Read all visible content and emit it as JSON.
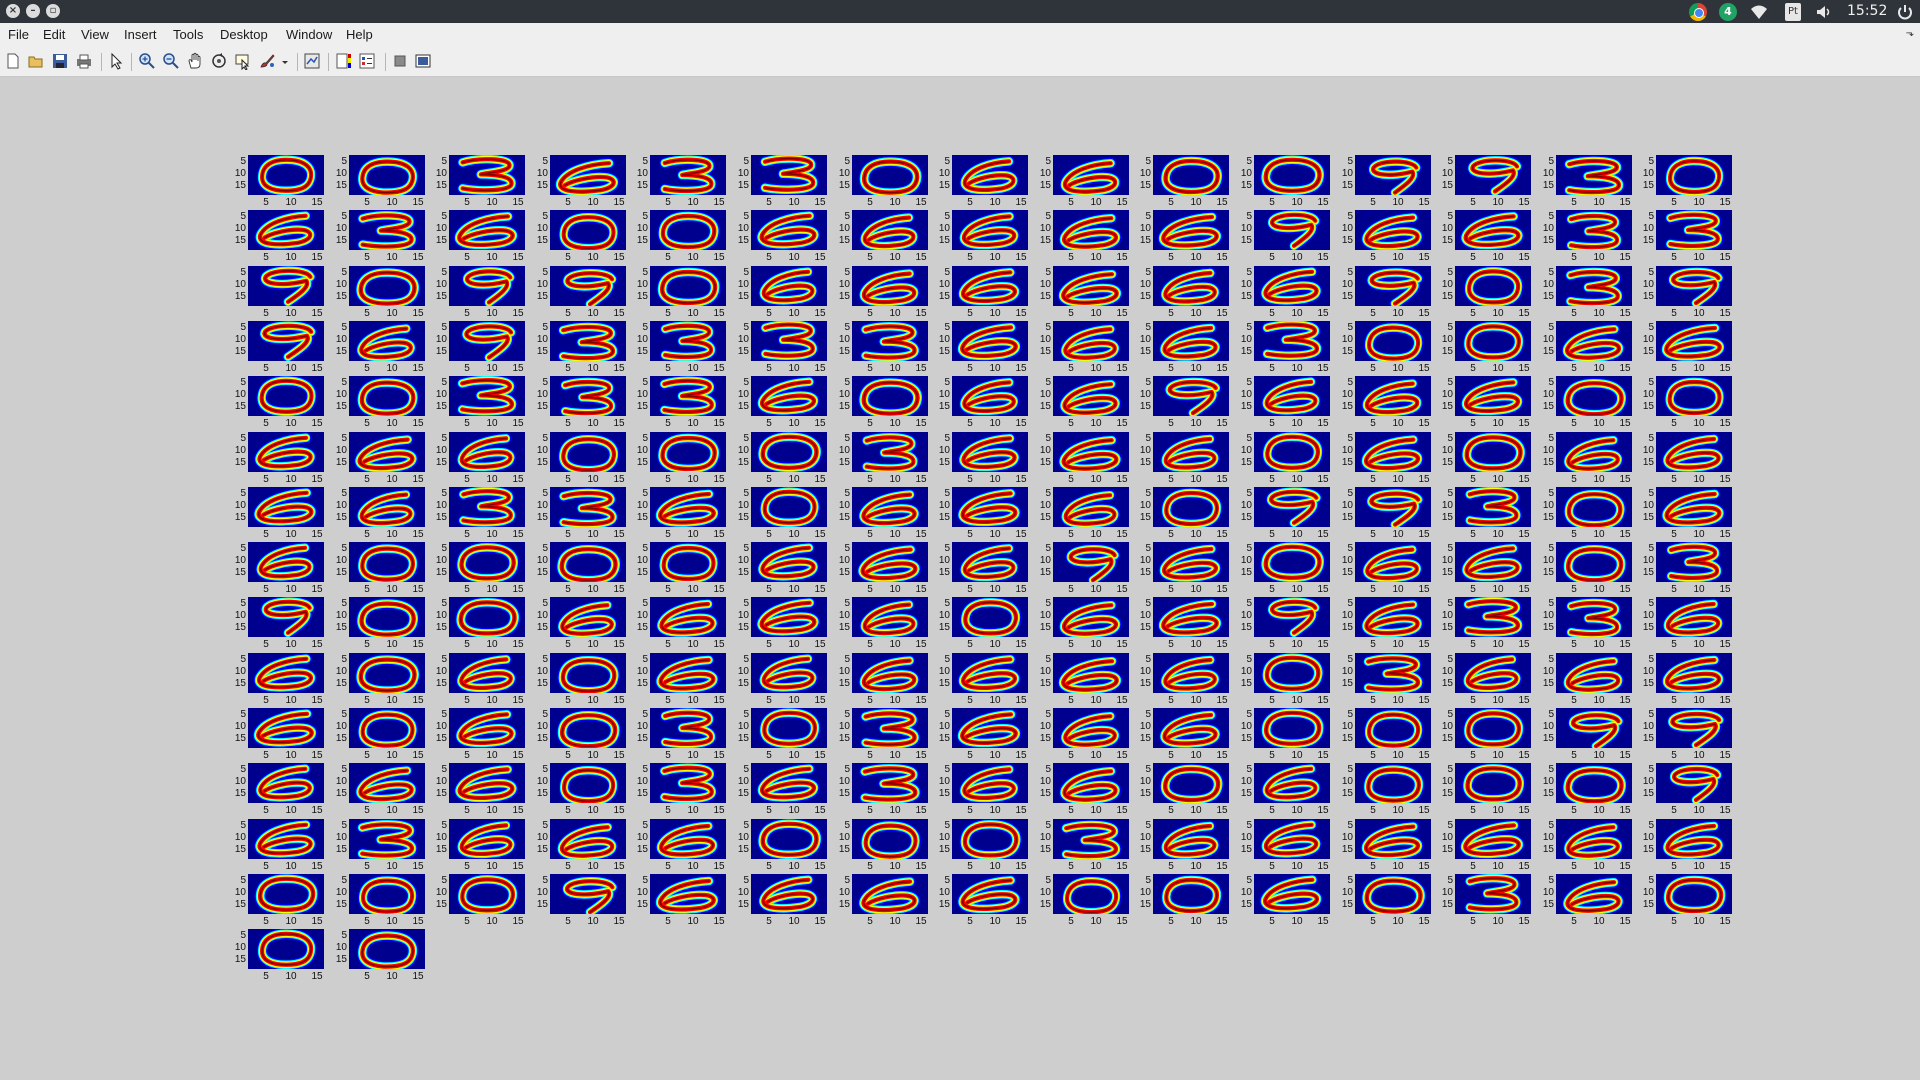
{
  "system_bar": {
    "window_buttons": [
      "close-icon",
      "minimize-icon",
      "maximize-icon"
    ],
    "badge_count": "4",
    "keyboard_layout": "Pt",
    "clock": "15:52",
    "tray_icons": [
      "chrome-icon",
      "notification-badge-icon",
      "wifi-icon",
      "keyboard-layout-icon",
      "volume-icon",
      "power-icon"
    ]
  },
  "menubar": {
    "items": [
      {
        "label": "File"
      },
      {
        "label": "Edit"
      },
      {
        "label": "View"
      },
      {
        "label": "Insert"
      },
      {
        "label": "Tools"
      },
      {
        "label": "Desktop"
      },
      {
        "label": "Window"
      },
      {
        "label": "Help"
      }
    ]
  },
  "toolbar": {
    "buttons": [
      "new-figure-icon",
      "open-file-icon",
      "save-icon",
      "print-icon",
      "edit-plot-icon",
      "zoom-in-icon",
      "zoom-out-icon",
      "pan-icon",
      "rotate-3d-icon",
      "data-cursor-icon",
      "brush-icon",
      "link-plot-icon",
      "colorbar-icon",
      "legend-icon",
      "hide-plot-tools-icon",
      "show-plot-tools-icon"
    ]
  },
  "figure": {
    "y_ticks": [
      "5",
      "10",
      "15"
    ],
    "x_ticks": [
      "5",
      "10",
      "15"
    ],
    "colormap": [
      "#00008f",
      "#0000ff",
      "#00ffff",
      "#ffff00",
      "#ff0000",
      "#800000"
    ],
    "grid_columns": 15,
    "subplots": [
      "0",
      "0",
      "3",
      "6",
      "3",
      "3",
      "0",
      "6",
      "6",
      "0",
      "0",
      "9",
      "9",
      "3",
      "0",
      "6",
      "3",
      "6",
      "0",
      "0",
      "6",
      "6",
      "6",
      "6",
      "6",
      "9",
      "6",
      "6",
      "3",
      "3",
      "9",
      "0",
      "9",
      "9",
      "0",
      "6",
      "6",
      "6",
      "6",
      "6",
      "6",
      "9",
      "0",
      "3",
      "9",
      "9",
      "6",
      "9",
      "3",
      "3",
      "3",
      "3",
      "6",
      "6",
      "6",
      "3",
      "0",
      "0",
      "6",
      "6",
      "0",
      "0",
      "3",
      "3",
      "3",
      "6",
      "0",
      "6",
      "6",
      "9",
      "6",
      "6",
      "6",
      "0",
      "0",
      "6",
      "6",
      "6",
      "0",
      "0",
      "0",
      "3",
      "6",
      "6",
      "6",
      "0",
      "6",
      "0",
      "6",
      "6",
      "6",
      "6",
      "3",
      "3",
      "6",
      "0",
      "6",
      "6",
      "6",
      "0",
      "9",
      "9",
      "3",
      "0",
      "6",
      "6",
      "0",
      "0",
      "0",
      "0",
      "6",
      "6",
      "6",
      "9",
      "6",
      "0",
      "6",
      "6",
      "0",
      "3",
      "9",
      "0",
      "0",
      "6",
      "6",
      "6",
      "6",
      "0",
      "6",
      "6",
      "9",
      "6",
      "3",
      "3",
      "6",
      "6",
      "0",
      "6",
      "0",
      "6",
      "6",
      "6",
      "6",
      "6",
      "6",
      "0",
      "3",
      "6",
      "6",
      "6",
      "6",
      "0",
      "6",
      "0",
      "3",
      "0",
      "3",
      "6",
      "6",
      "6",
      "0",
      "0",
      "0",
      "9",
      "9",
      "6",
      "6",
      "6",
      "0",
      "3",
      "6",
      "3",
      "6",
      "6",
      "0",
      "6",
      "0",
      "0",
      "0",
      "9",
      "6",
      "3",
      "6",
      "6",
      "6",
      "0",
      "0",
      "0",
      "3",
      "6",
      "6",
      "6",
      "6",
      "6",
      "6",
      "0",
      "0",
      "0",
      "9",
      "6",
      "6",
      "6",
      "6",
      "0",
      "0",
      "6",
      "0",
      "3",
      "6",
      "0",
      "0",
      "0"
    ]
  }
}
